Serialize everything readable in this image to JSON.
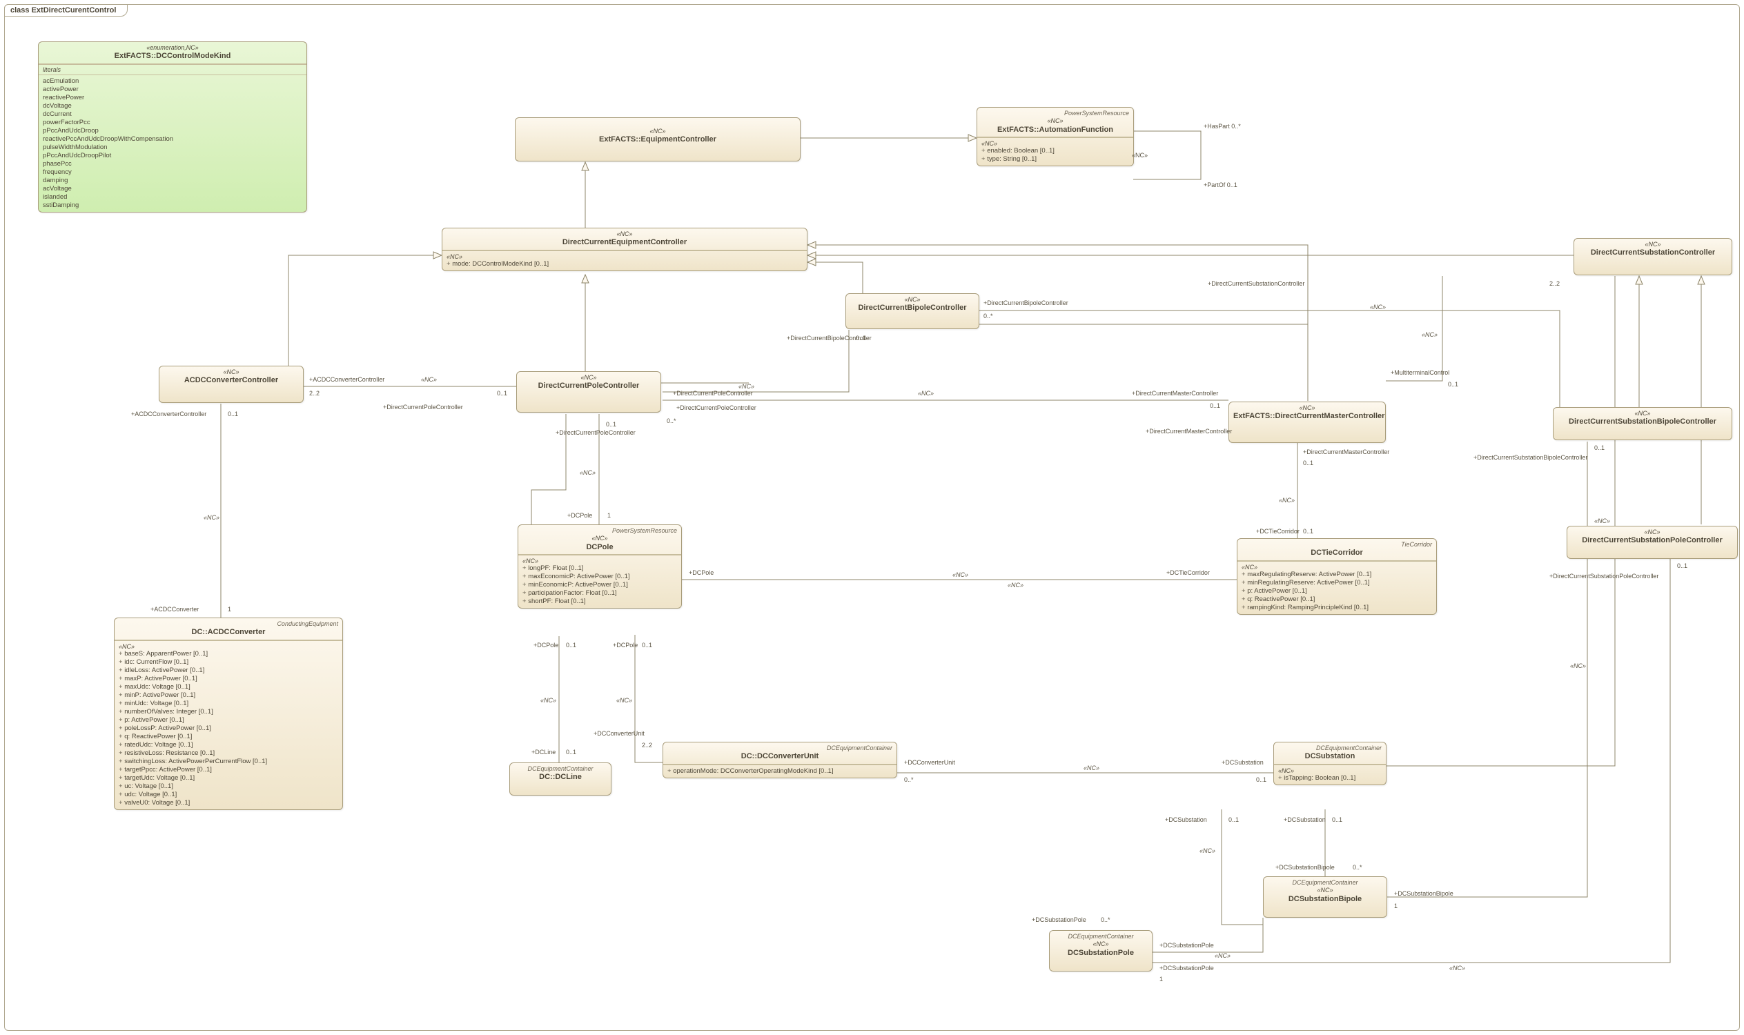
{
  "diagram": {
    "title": "class ExtDirectCurentControl"
  },
  "enum": {
    "stereo": "«enumeration,NC»",
    "name": "ExtFACTS::DCControlModeKind",
    "lit_header": "literals",
    "literals": [
      "acEmulation",
      "activePower",
      "reactivePower",
      "dcVoltage",
      "dcCurrent",
      "powerFactorPcc",
      "pPccAndUdcDroop",
      "reactivePccAndUdcDroopWithCompensation",
      "pulseWidthModulation",
      "pPccAndUdcDroopPilot",
      "phasePcc",
      "frequency",
      "damping",
      "acVoltage",
      "islanded",
      "sstiDamping"
    ]
  },
  "classes": {
    "equipCtrl": {
      "stereo": "«NC»",
      "name": "ExtFACTS::EquipmentController"
    },
    "autoFunc": {
      "super": "PowerSystemResource",
      "stereo": "«NC»",
      "name": "ExtFACTS::AutomationFunction",
      "sectStereo": "«NC»",
      "attrs": [
        "enabled: Boolean [0..1]",
        "type: String [0..1]"
      ]
    },
    "dceqCtrl": {
      "stereo": "«NC»",
      "name": "DirectCurrentEquipmentController",
      "sectStereo": "«NC»",
      "attrs": [
        "mode: DCControlModeKind [0..1]"
      ]
    },
    "bipoleCtrl": {
      "stereo": "«NC»",
      "name": "DirectCurrentBipoleController"
    },
    "acdcCtrl": {
      "stereo": "«NC»",
      "name": "ACDCConverterController"
    },
    "poleCtrl": {
      "stereo": "«NC»",
      "name": "DirectCurrentPoleController"
    },
    "masterCtrl": {
      "stereo": "«NC»",
      "name": "ExtFACTS::DirectCurrentMasterController"
    },
    "subCtrl": {
      "stereo": "«NC»",
      "name": "DirectCurrentSubstationController"
    },
    "subBipoleCtrl": {
      "stereo": "«NC»",
      "name": "DirectCurrentSubstationBipoleController"
    },
    "subPoleCtrl": {
      "stereo": "«NC»",
      "name": "DirectCurrentSubstationPoleController"
    },
    "acdcConv": {
      "super": "ConductingEquipment",
      "name": "DC::ACDCConverter",
      "sectStereo": "«NC»",
      "attrs": [
        "baseS: ApparentPower [0..1]",
        "idc: CurrentFlow [0..1]",
        "idleLoss: ActivePower [0..1]",
        "maxP: ActivePower [0..1]",
        "maxUdc: Voltage [0..1]",
        "minP: ActivePower [0..1]",
        "minUdc: Voltage [0..1]",
        "numberOfValves: Integer [0..1]",
        "p: ActivePower [0..1]",
        "poleLossP: ActivePower [0..1]",
        "q: ReactivePower [0..1]",
        "ratedUdc: Voltage [0..1]",
        "resistiveLoss: Resistance [0..1]",
        "switchingLoss: ActivePowerPerCurrentFlow [0..1]",
        "targetPpcc: ActivePower [0..1]",
        "targetUdc: Voltage [0..1]",
        "uc: Voltage [0..1]",
        "udc: Voltage [0..1]",
        "valveU0: Voltage [0..1]"
      ]
    },
    "dcpole": {
      "super": "PowerSystemResource",
      "stereo": "«NC»",
      "name": "DCPole",
      "sectStereo": "«NC»",
      "attrs": [
        "longPF: Float [0..1]",
        "maxEconomicP: ActivePower [0..1]",
        "minEconomicP: ActivePower [0..1]",
        "participationFactor: Float [0..1]",
        "shortPF: Float [0..1]"
      ]
    },
    "tie": {
      "super": "TieCorridor",
      "name": "DCTieCorridor",
      "sectStereo": "«NC»",
      "attrs": [
        "maxRegulatingReserve: ActivePower [0..1]",
        "minRegulatingReserve: ActivePower [0..1]",
        "p: ActivePower [0..1]",
        "q: ReactivePower [0..1]",
        "rampingKind: RampingPrincipleKind [0..1]"
      ]
    },
    "dcline": {
      "super": "DCEquipmentContainer",
      "name": "DC::DCLine"
    },
    "dccu": {
      "super": "DCEquipmentContainer",
      "name": "DC::DCConverterUnit",
      "attrs": [
        "operationMode: DCConverterOperatingModeKind [0..1]"
      ]
    },
    "dcsub": {
      "super": "DCEquipmentContainer",
      "name": "DCSubstation",
      "sectStereo": "«NC»",
      "attrs": [
        "isTapping: Boolean [0..1]"
      ]
    },
    "dcsubbi": {
      "super": "DCEquipmentContainer",
      "stereo": "«NC»",
      "name": "DCSubstationBipole"
    },
    "dcsubpo": {
      "super": "DCEquipmentContainer",
      "stereo": "«NC»",
      "name": "DCSubstationPole"
    }
  },
  "labels": {
    "nc": "«NC»",
    "hasPart": "+HasPart 0..*",
    "partOf": "+PartOf 0..1",
    "acdcCtrlRole": "+ACDCConverterController",
    "acdcConvRole": "+ACDCConverter",
    "dcPoleCtrlRole": "+DirectCurrentPoleController",
    "dcpoleRole": "+DCPole",
    "dcBipoleCtrlRole": "+DirectCurrentBipoleController",
    "dcSubCtrlRole": "+DirectCurrentSubstationController",
    "dcMasterCtrlRole": "+DirectCurrentMasterController",
    "multiCtrl": "+MultiterminalControl",
    "dcTieRole": "+DCTieCorridor",
    "dclineRole": "+DCLine",
    "dccuRole": "+DCConverterUnit",
    "dcsubRole": "+DCSubstation",
    "dcsubbiRole": "+DCSubstationBipole",
    "dcsubpoRole": "+DCSubstationPole",
    "dcsubBipoleCtrlRole": "+DirectCurrentSubstationBipoleController",
    "dcsubPoleCtrlRole": "+DirectCurrentSubstationPoleController",
    "m01": "0..1",
    "m0s": "0..*",
    "m1": "1",
    "m22": "2..2"
  }
}
